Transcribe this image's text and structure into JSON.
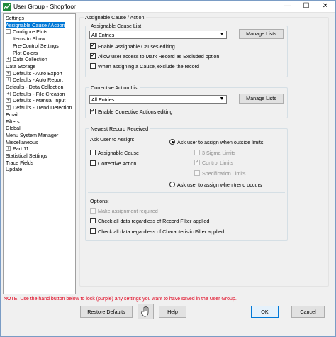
{
  "window": {
    "title": "User Group - Shopfloor",
    "controls": {
      "minimize": "—",
      "maximize": "☐",
      "close": "✕"
    }
  },
  "tree": [
    {
      "label": "Settings",
      "expandable": false,
      "selected": false
    },
    {
      "label": "Assignable Cause / Action",
      "expandable": false,
      "selected": true
    },
    {
      "label": "Configure Plots",
      "expandable": true,
      "expanded": true
    },
    {
      "label": "Items to Show",
      "child": true
    },
    {
      "label": "Pre-Control Settings",
      "child": true
    },
    {
      "label": "Plot Colors",
      "child": true
    },
    {
      "label": "Data Collection",
      "expandable": true
    },
    {
      "label": "Data Storage",
      "expandable": false
    },
    {
      "label": "Defaults - Auto Export",
      "expandable": true
    },
    {
      "label": "Defaults - Auto Report",
      "expandable": true
    },
    {
      "label": "Defaults - Data Collection",
      "expandable": false
    },
    {
      "label": "Defaults - File Creation",
      "expandable": true
    },
    {
      "label": "Defaults - Manual Input",
      "expandable": true
    },
    {
      "label": "Defaults - Trend Detection",
      "expandable": true
    },
    {
      "label": "Email",
      "expandable": false
    },
    {
      "label": "Filters",
      "expandable": false
    },
    {
      "label": "Global",
      "expandable": false
    },
    {
      "label": "Menu System Manager",
      "expandable": false
    },
    {
      "label": "Miscellaneous",
      "expandable": false
    },
    {
      "label": "Part 11",
      "expandable": true
    },
    {
      "label": "Statistical Settings",
      "expandable": false
    },
    {
      "label": "Trace Fields",
      "expandable": false
    },
    {
      "label": "Update",
      "expandable": false
    }
  ],
  "main": {
    "section_title": "Assignable Cause / Action",
    "assignable": {
      "title": "Assignable Cause List",
      "dropdown": "All Entries",
      "manage_button": "Manage Lists",
      "enable_editing": "Enable Assignable Causes editing",
      "allow_excluded": "Allow user access to Mark Record as Excluded option",
      "exclude_record": "When assigning a Cause, exclude the record"
    },
    "corrective": {
      "title": "Corrective Action List",
      "dropdown": "All Entries",
      "manage_button": "Manage Lists",
      "enable_editing": "Enable Corrective Actions editing"
    },
    "newest": {
      "title": "Newest Record Received",
      "ask_user": "Ask User to Assign:",
      "assignable_cause": "Assignable Cause",
      "corrective_action": "Corrective Action",
      "outside_limits": "Ask user to assign when outside limits",
      "sigma_limits": "3 Sigma Limits",
      "control_limits": "Control Limits",
      "spec_limits": "Specification Limits",
      "trend": "Ask user to assign when trend occurs",
      "options": "Options:",
      "make_required": "Make assignment required",
      "check_record_filter": "Check all data regardless of Record Filter applied",
      "check_char_filter": "Check all data regardless of Characteristic Filter applied"
    }
  },
  "footer": {
    "note": "NOTE: Use the hand button below to lock (purple) any settings you want to have saved in the User Group.",
    "restore": "Restore Defaults",
    "help": "Help",
    "ok": "OK",
    "cancel": "Cancel"
  }
}
